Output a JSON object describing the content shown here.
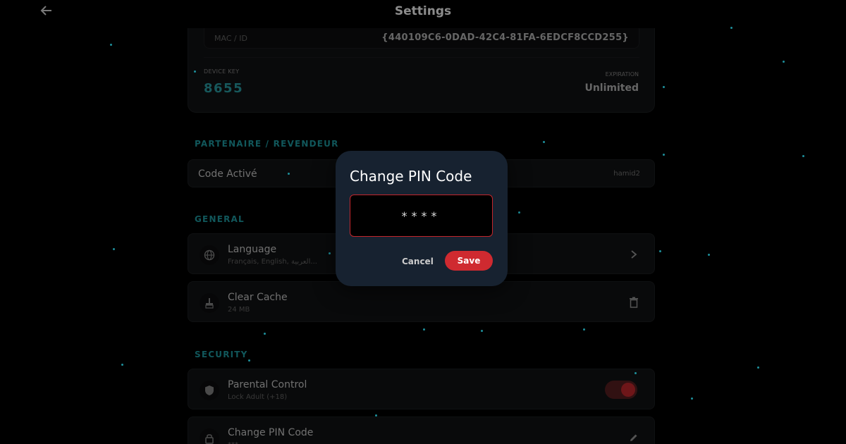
{
  "header": {
    "title": "Settings"
  },
  "device": {
    "mac_label": "MAC / ID",
    "mac_value": "{440109C6-0DAD-42C4-81FA-6EDCF8CCD255}",
    "device_key_label": "DEVICE KEY",
    "device_key_value": "8655",
    "expiration_label": "EXPIRATION",
    "expiration_value": "Unlimited"
  },
  "partner": {
    "section_label": "PARTENAIRE / REVENDEUR",
    "row_label": "Code Activé",
    "row_value": "hamid2"
  },
  "general": {
    "section_label": "GENERAL",
    "language": {
      "title": "Language",
      "subtitle": "Français, English, العربية..."
    },
    "cache": {
      "title": "Clear Cache",
      "subtitle": "24 MB"
    }
  },
  "security": {
    "section_label": "SECURITY",
    "parental": {
      "title": "Parental Control",
      "subtitle": "Lock Adult (+18)",
      "enabled": true
    },
    "pin": {
      "title": "Change PIN Code",
      "subtitle": "***"
    }
  },
  "dialog": {
    "title": "Change PIN Code",
    "pin_value": "****",
    "cancel_label": "Cancel",
    "save_label": "Save"
  },
  "colors": {
    "accent": "#1f9fa6",
    "danger": "#cf2a30",
    "dialog_bg": "#172230"
  },
  "icons": [
    "back-arrow-icon",
    "globe-icon",
    "chevron-right-icon",
    "broom-icon",
    "trash-icon",
    "shield-icon",
    "lock-icon",
    "pencil-icon"
  ]
}
